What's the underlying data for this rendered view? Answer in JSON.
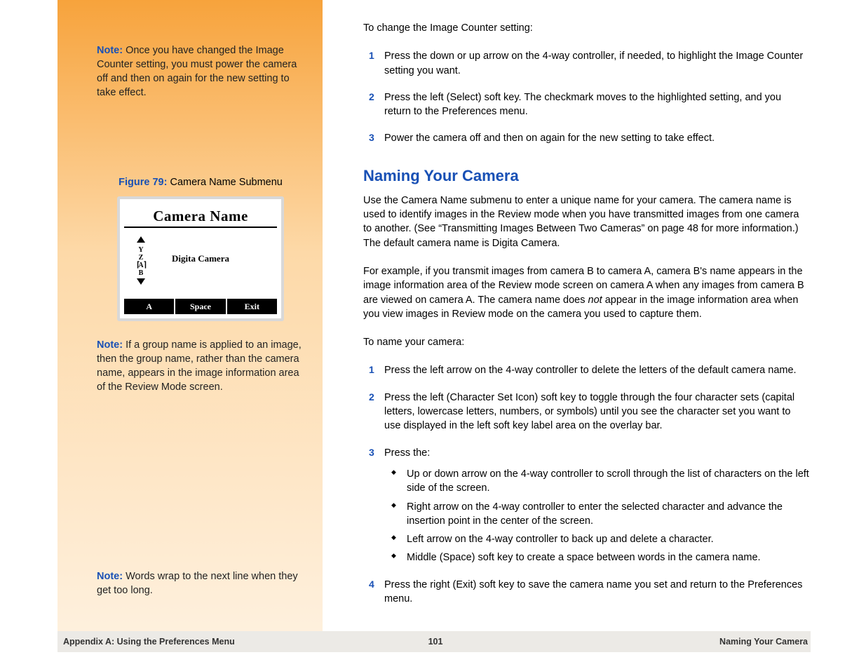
{
  "sidebar": {
    "note1_label": "Note:",
    "note1_text": " Once you have changed the Image Counter setting, you must power the camera off and then on again for the new setting to take effect.",
    "figure_label": "Figure 79:",
    "figure_caption": " Camera Name Submenu",
    "screen_title": "Camera Name",
    "screen_value": "Digita Camera",
    "screen_letters_top": "Y",
    "screen_letters_mid": "Z",
    "screen_letters_a": "A",
    "screen_letters_bot": "B",
    "screen_softkey_left": "A",
    "screen_softkey_mid": "Space",
    "screen_softkey_right": "Exit",
    "note2_label": "Note:",
    "note2_text": " If a group name is applied to an image, then the group name, rather than the camera name, appears in the image information area of the Review Mode screen.",
    "note3_label": "Note:",
    "note3_text": " Words wrap to the next line when they get too long."
  },
  "main": {
    "intro1": "To change the Image Counter setting:",
    "steps1": [
      "Press the down or up arrow on the 4-way controller, if needed, to highlight the Image Counter setting you want.",
      "Press the left (Select) soft key. The checkmark moves to the highlighted setting, and you return to the Preferences menu.",
      "Power the camera off and then on again for the new setting to take effect."
    ],
    "heading": "Naming Your Camera",
    "para1": "Use the Camera Name submenu to enter a unique name for your camera. The camera name is used to identify images in the Review mode when you have transmitted images from one camera to another. (See “Transmitting Images Between Two Cameras” on page 48 for more information.) The default camera name is Digita Camera.",
    "para2a": "For example, if you transmit images from camera B to camera A, camera B's name appears in the image information area of the Review mode screen on camera A when any images from camera B are viewed on camera A. The camera name does ",
    "para2b_italic": "not",
    "para2c": " appear in the image information area when you view images in Review mode on the camera you used to capture them.",
    "intro2": "To name your camera:",
    "steps2": [
      "Press the left arrow on the 4-way controller to delete the letters of the default camera name.",
      "Press the left (Character Set Icon) soft key to toggle through the four character sets (capital letters, lowercase letters, numbers, or symbols) until you see the character set you want to use displayed in the left soft key label area on the overlay bar.",
      "Press the:",
      "Press the right (Exit) soft key to save the camera name you set and return to the Preferences menu."
    ],
    "bullets": [
      "Up or down arrow on the 4-way controller to scroll through the list of characters on the left side of the screen.",
      "Right arrow on the 4-way controller to enter the selected character and advance the insertion point in the center of the screen.",
      "Left arrow on the 4-way controller to back up and delete a character.",
      "Middle (Space) soft key to create a space between words in the camera name."
    ]
  },
  "footer": {
    "left": "Appendix A: Using the Preferences Menu",
    "center": "101",
    "right": "Naming Your Camera"
  }
}
